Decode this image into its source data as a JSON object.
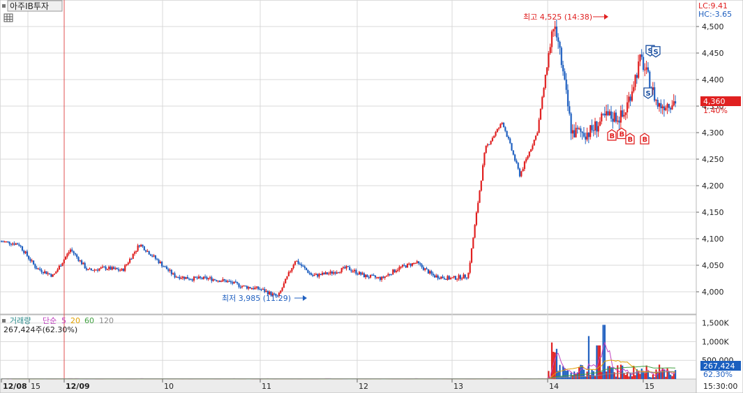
{
  "header": {
    "stock_name": "아주IB투자",
    "lc_label": "LC:9.41",
    "hc_label": "HC:-3.65"
  },
  "price_panel": {
    "y_ticks": [
      "4,500",
      "4,450",
      "4,400",
      "4,350",
      "4,300",
      "4,250",
      "4,200",
      "4,150",
      "4,100",
      "4,050",
      "4,000"
    ],
    "current_price": "4,360",
    "change_pct": "1.40%",
    "high_label": "최고 4,525 (14:38)",
    "low_label": "최저 3,985 (11:29)",
    "signals": [
      "S",
      "S",
      "S",
      "B",
      "B",
      "B",
      "B"
    ]
  },
  "volume_panel": {
    "legend_volume": "거래량",
    "legend_simple": "단순",
    "ma_labels": [
      "5",
      "20",
      "60",
      "120"
    ],
    "current_volume": "267,424주(62.30%)",
    "y_ticks": [
      "1,500K",
      "1,000K",
      "500,000"
    ],
    "volume_badge": "267,424",
    "volume_pct": "62.30%"
  },
  "x_axis": {
    "labels": [
      "12/08",
      "15",
      "12/09",
      "10",
      "11",
      "12",
      "13",
      "14",
      "15"
    ],
    "time_label": "15:30:00"
  },
  "colors": {
    "up": "#e02020",
    "down": "#2060c0",
    "grid": "#d8d8d8",
    "ma5": "#c040c0",
    "ma20": "#e0a000",
    "ma60": "#40a040",
    "ma120": "#888888"
  },
  "chart_data": {
    "type": "candlestick",
    "ylim": [
      3960,
      4540
    ],
    "points": [
      {
        "x": "12/08 15",
        "price": 4095
      },
      {
        "x": "12/09 09",
        "price": 4090
      },
      {
        "x": "12/09 10",
        "price": 4045
      },
      {
        "x": "12/09 11",
        "price": 4030
      },
      {
        "x": "12/09 12",
        "price": 4080
      },
      {
        "x": "12/09 13",
        "price": 4040
      },
      {
        "x": "12/09 14",
        "price": 4045
      },
      {
        "x": "12/09 15",
        "price": 4040
      },
      {
        "x": "12/10 09",
        "price": 4090
      },
      {
        "x": "12/10 10",
        "price": 4060
      },
      {
        "x": "12/10 11",
        "price": 4030
      },
      {
        "x": "12/10 12",
        "price": 4025
      },
      {
        "x": "12/10 13",
        "price": 4025
      },
      {
        "x": "12/10 14",
        "price": 4020
      },
      {
        "x": "12/11 09",
        "price": 4010
      },
      {
        "x": "12/11 10",
        "price": 4005
      },
      {
        "x": "12/11 11",
        "price": 3990
      },
      {
        "x": "12/11 12",
        "price": 4060
      },
      {
        "x": "12/11 14",
        "price": 4030
      },
      {
        "x": "12/12 09",
        "price": 4035
      },
      {
        "x": "12/12 11",
        "price": 4045
      },
      {
        "x": "12/12 13",
        "price": 4030
      },
      {
        "x": "12/12 15",
        "price": 4025
      },
      {
        "x": "12/13 10",
        "price": 4045
      },
      {
        "x": "12/13 11",
        "price": 4055
      },
      {
        "x": "12/13 13",
        "price": 4030
      },
      {
        "x": "12/13 15",
        "price": 4025
      },
      {
        "x": "12/14 09",
        "price": 4030
      },
      {
        "x": "12/14 10",
        "price": 4270
      },
      {
        "x": "12/14 11",
        "price": 4320
      },
      {
        "x": "12/14 12",
        "price": 4220
      },
      {
        "x": "12/14 13",
        "price": 4300
      },
      {
        "x": "12/14 14",
        "price": 4520
      },
      {
        "x": "12/14 15",
        "price": 4300
      },
      {
        "x": "12/15 09",
        "price": 4300
      },
      {
        "x": "12/15 10",
        "price": 4330
      },
      {
        "x": "12/15 11",
        "price": 4330
      },
      {
        "x": "12/15 12",
        "price": 4440
      },
      {
        "x": "12/15 13",
        "price": 4350
      },
      {
        "x": "12/15 14",
        "price": 4360
      }
    ]
  }
}
